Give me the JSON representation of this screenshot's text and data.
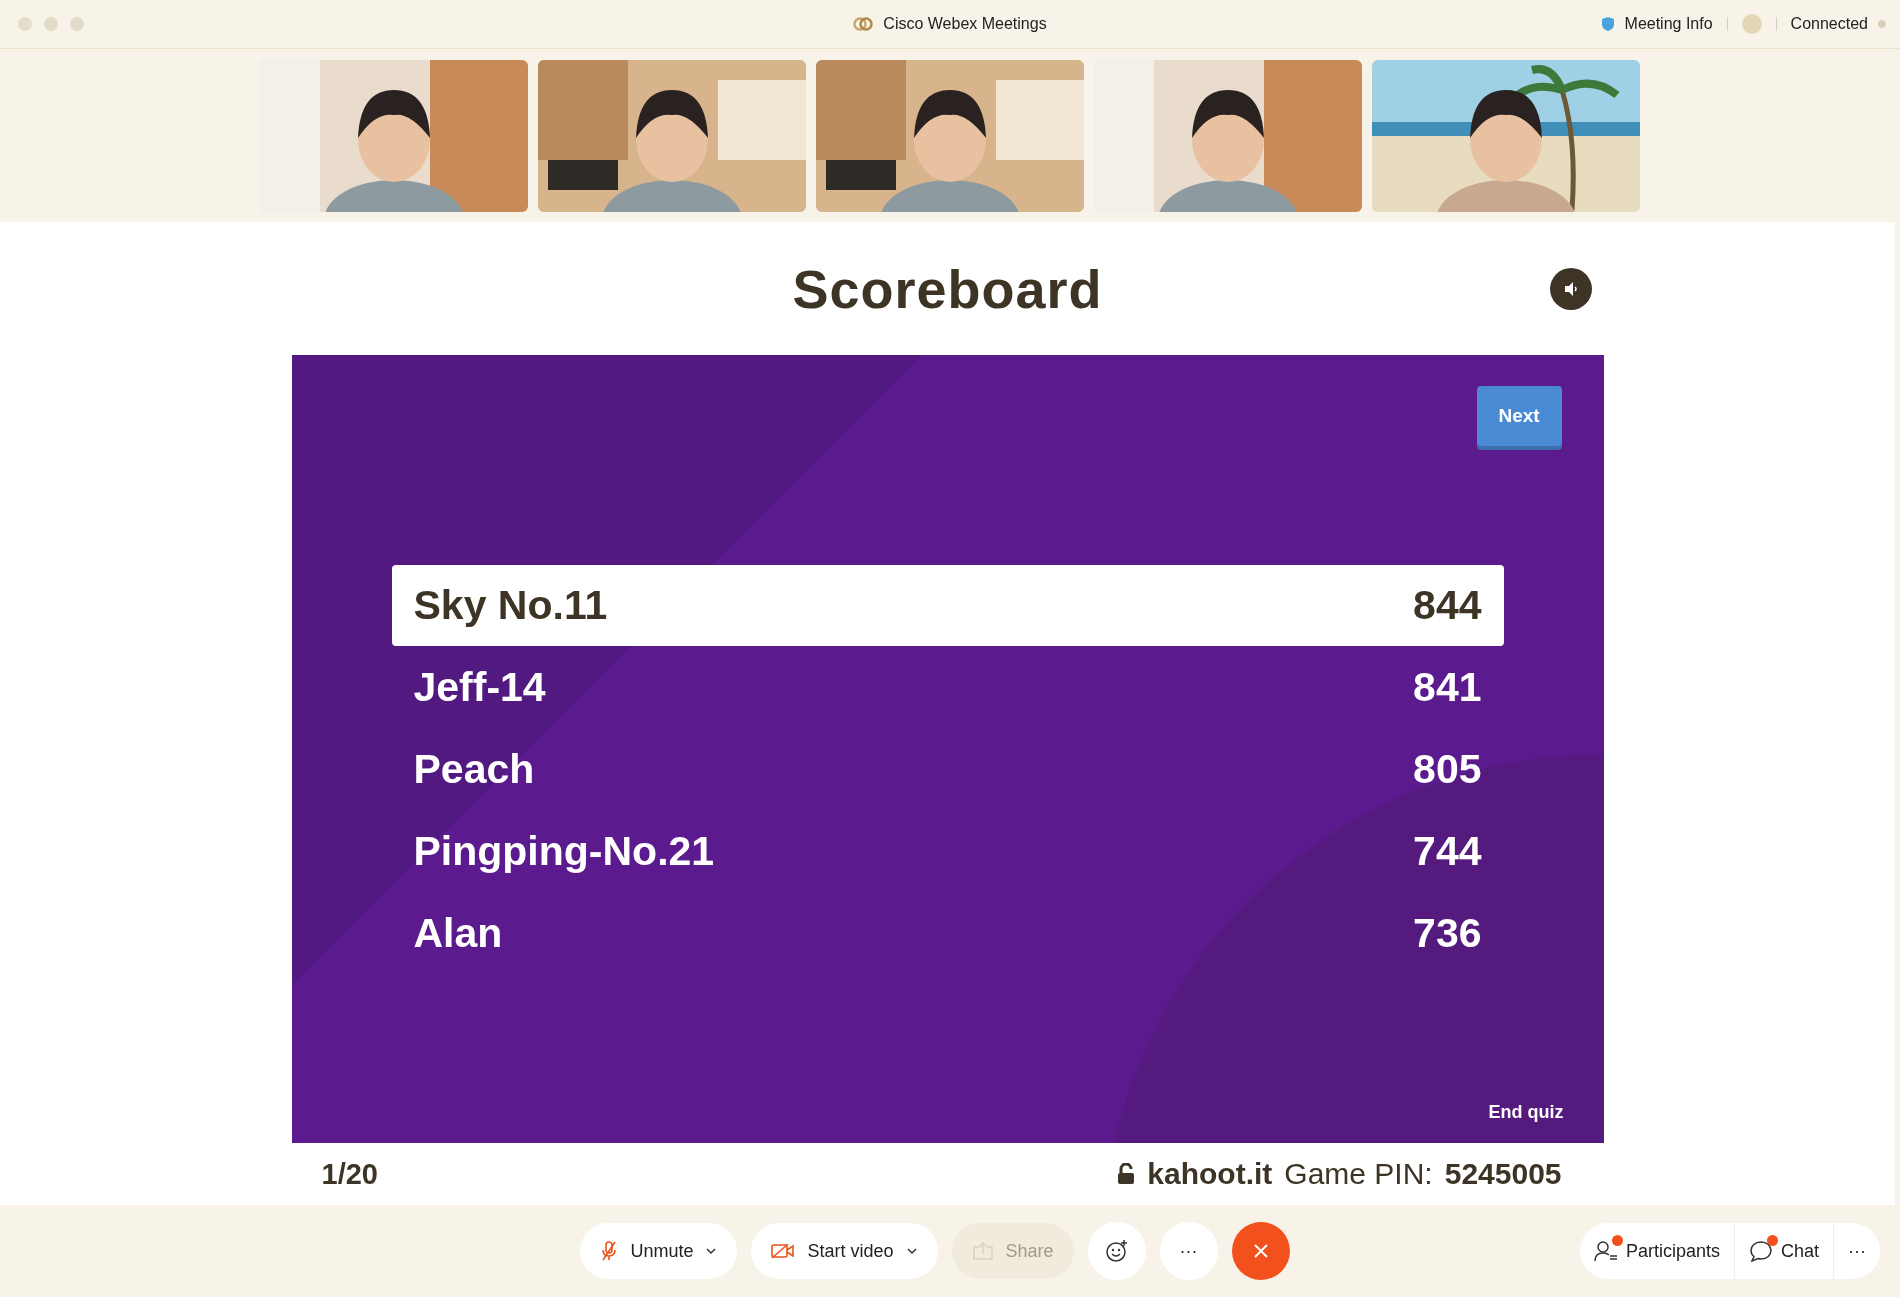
{
  "window": {
    "title": "Cisco Webex Meetings",
    "meeting_info": "Meeting Info",
    "status": "Connected"
  },
  "scoreboard": {
    "title": "Scoreboard",
    "next": "Next",
    "end": "End quiz",
    "rows": [
      {
        "name": "Sky No.11",
        "score": "844",
        "selected": true
      },
      {
        "name": "Jeff-14",
        "score": "841",
        "selected": false
      },
      {
        "name": "Peach",
        "score": "805",
        "selected": false
      },
      {
        "name": "Pingping-No.21",
        "score": "744",
        "selected": false
      },
      {
        "name": "Alan",
        "score": "736",
        "selected": false
      }
    ],
    "progress": "1/20",
    "site": "kahoot.it",
    "pin_label": "Game PIN:",
    "pin": "5245005"
  },
  "toolbar": [
    {
      "kind": "mic",
      "label": "Unmute",
      "disabled": false
    },
    {
      "kind": "video",
      "label": "Start video",
      "disabled": false
    },
    {
      "kind": "share",
      "label": "Share",
      "disabled": true
    },
    {
      "kind": "emoji",
      "disabled": false
    },
    {
      "kind": "more",
      "label": "···",
      "disabled": false
    },
    {
      "kind": "leave",
      "disabled": false
    }
  ],
  "side_toolbar": [
    {
      "kind": "participants",
      "label": "Participants",
      "badge": true
    },
    {
      "kind": "chat",
      "label": "Chat",
      "badge": true
    },
    {
      "kind": "more",
      "label": "···"
    }
  ]
}
